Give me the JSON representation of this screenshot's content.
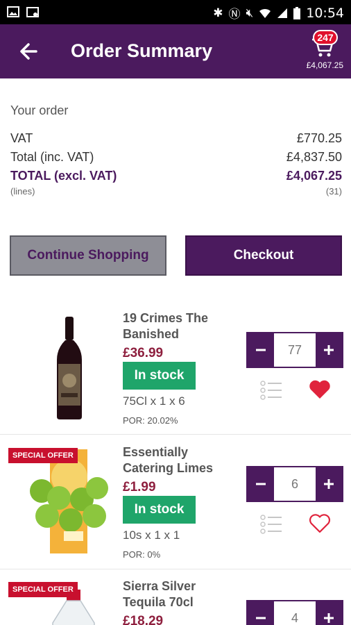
{
  "status_bar": {
    "time": "10:54"
  },
  "header": {
    "title": "Order Summary",
    "cart_count": "247",
    "cart_total": "£4,067.25"
  },
  "summary": {
    "heading": "Your order",
    "rows": [
      {
        "label": "VAT",
        "value": "£770.25"
      },
      {
        "label": "Total (inc. VAT)",
        "value": "£4,837.50"
      },
      {
        "label": "TOTAL (excl. VAT)",
        "value": "£4,067.25"
      },
      {
        "label": "(lines)",
        "value": "(31)"
      }
    ]
  },
  "buttons": {
    "continue": "Continue Shopping",
    "checkout": "Checkout"
  },
  "products": [
    {
      "name": "19 Crimes The Banished",
      "price": "£36.99",
      "stock": "In stock",
      "pack": "75Cl x 1 x 6",
      "por": "POR: 20.02%",
      "qty": "77",
      "favourite": true
    },
    {
      "badge": "SPECIAL OFFER",
      "name": "Essentially Catering Limes",
      "price": "£1.99",
      "stock": "In stock",
      "pack": "10s x 1 x 1",
      "por": "POR: 0%",
      "qty": "6",
      "favourite": false
    },
    {
      "badge": "SPECIAL OFFER",
      "name": "Sierra Silver Tequila 70cl",
      "price": "£18.29",
      "qty": "4"
    }
  ],
  "colors": {
    "brand": "#4b1a5e",
    "price": "#8e1f3e",
    "in_stock": "#1fa56a",
    "offer_badge": "#c8102e",
    "heart": "#e0233c"
  }
}
